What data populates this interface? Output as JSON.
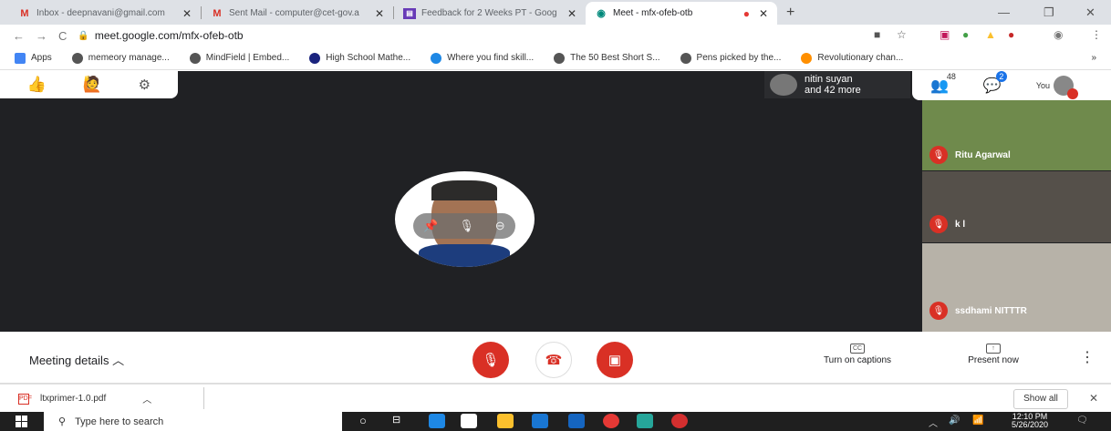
{
  "browser": {
    "tabs": [
      {
        "title": "Inbox - deepnavani@gmail.com",
        "icon": "gmail-icon",
        "color": "#d93025",
        "active": false
      },
      {
        "title": "Sent Mail - computer@cet-gov.a",
        "icon": "gmail-icon",
        "color": "#d93025",
        "active": false
      },
      {
        "title": "Feedback for 2 Weeks PT - Goog",
        "icon": "forms-icon",
        "color": "#673ab7",
        "active": false
      },
      {
        "title": "Meet - mfx-ofeb-otb",
        "icon": "meet-icon",
        "color": "#00897b",
        "active": true
      }
    ],
    "url": "meet.google.com/mfx-ofeb-otb",
    "bookmarks": [
      {
        "label": "Apps",
        "color": "#4285f4"
      },
      {
        "label": "memeory manage...",
        "color": "#555555"
      },
      {
        "label": "MindField | Embed...",
        "color": "#555555"
      },
      {
        "label": "High School Mathe...",
        "color": "#1a237e"
      },
      {
        "label": "Where you find skill...",
        "color": "#1e88e5"
      },
      {
        "label": "The 50 Best Short S...",
        "color": "#555555"
      },
      {
        "label": "Pens picked by the...",
        "color": "#555555"
      },
      {
        "label": "Revolutionary chan...",
        "color": "#ff8f00"
      }
    ],
    "bookmarks_more": "»"
  },
  "meet": {
    "people_pill": {
      "line1": "nitin suyan",
      "line2": "and 42 more"
    },
    "participants_count": "48",
    "chat_count": "2",
    "you_label": "You",
    "thumbnails": [
      {
        "name": "Ritu Agarwal",
        "bg": "#6f8a4c"
      },
      {
        "name": "k l",
        "bg": "#55504a"
      },
      {
        "name": "ssdhami NITTTR",
        "bg": "#b7b2a8"
      }
    ],
    "meeting_details": "Meeting details",
    "captions_label": "Turn on captions",
    "captions_icon_text": "CC",
    "present_label": "Present now",
    "colors": {
      "red": "#d93025",
      "dark": "#202124"
    }
  },
  "downloads": {
    "file": "ltxprimer-1.0.pdf",
    "pdf_icon_text": "PDF",
    "show_all": "Show all"
  },
  "taskbar": {
    "search_placeholder": "Type here to search",
    "time": "12:10 PM",
    "date": "5/26/2020"
  }
}
